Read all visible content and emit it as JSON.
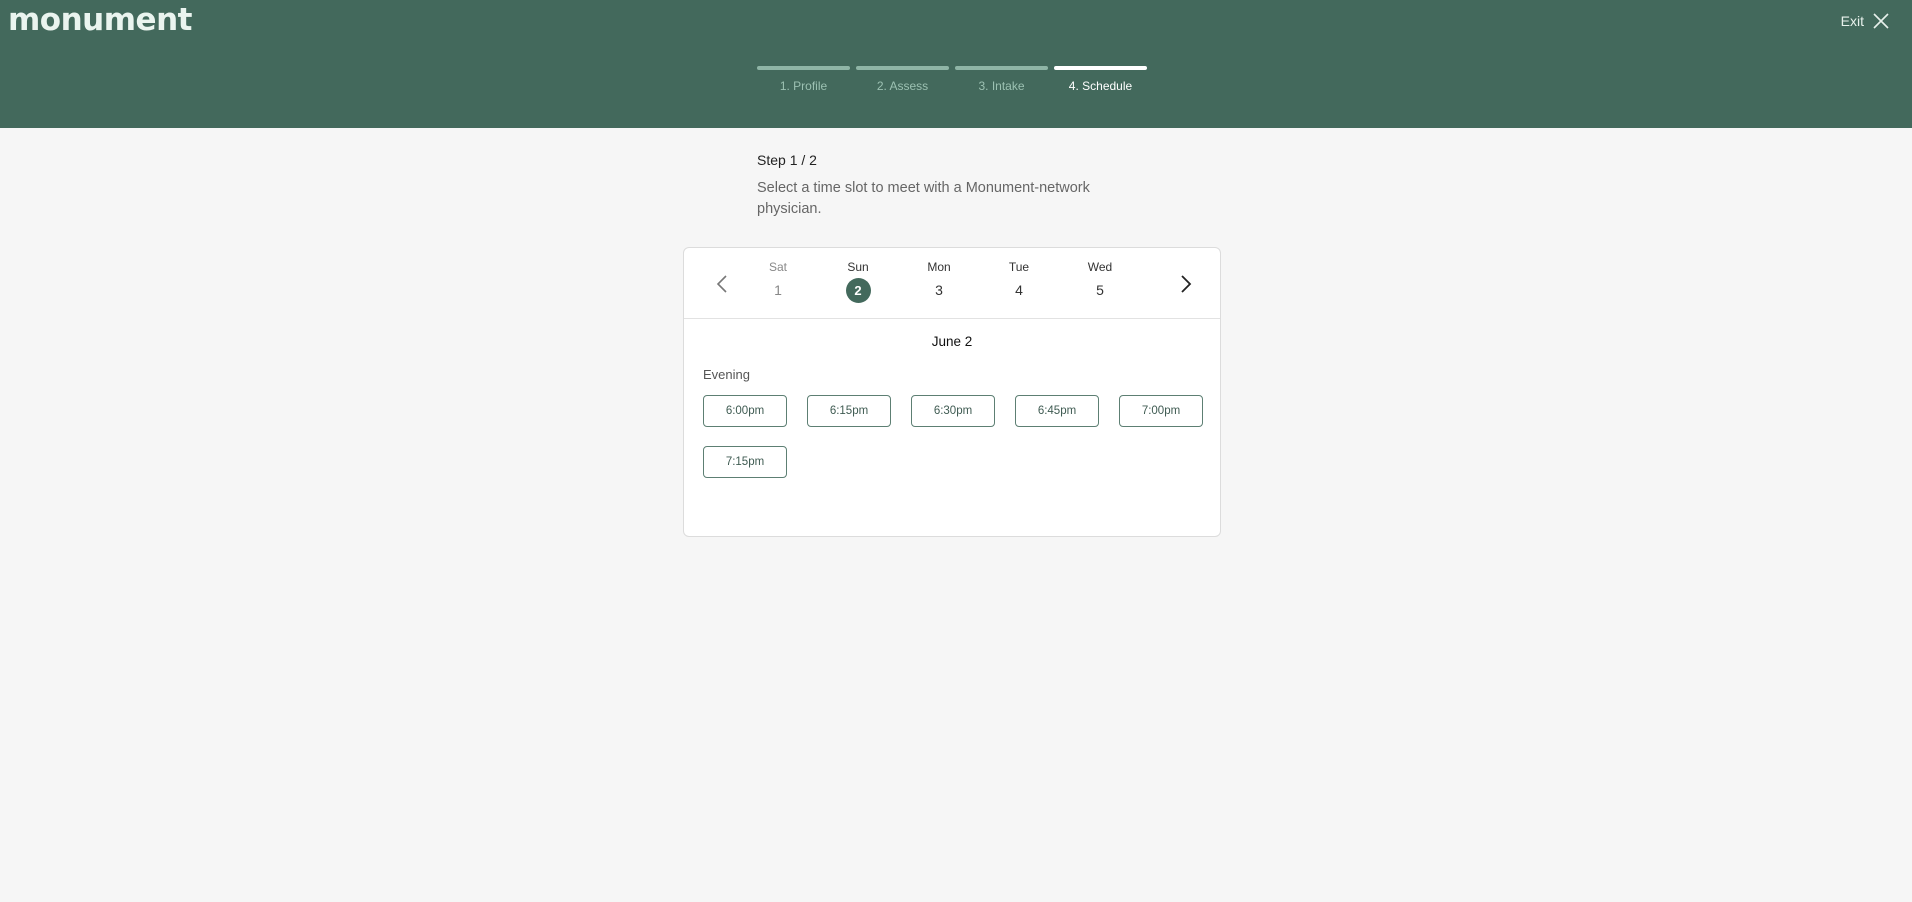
{
  "header": {
    "logo": "monument",
    "exit_label": "Exit",
    "background": "#43695c"
  },
  "stepper": {
    "steps": [
      {
        "label": "1. Profile",
        "active": false
      },
      {
        "label": "2. Assess",
        "active": false
      },
      {
        "label": "3. Intake",
        "active": false
      },
      {
        "label": "4. Schedule",
        "active": true
      }
    ]
  },
  "intro": {
    "step_count": "Step 1 / 2",
    "description": "Select a time slot to meet with a Monument-network physician."
  },
  "calendar": {
    "days": [
      {
        "name": "Sat",
        "date": "1"
      },
      {
        "name": "Sun",
        "date": "2"
      },
      {
        "name": "Mon",
        "date": "3"
      },
      {
        "name": "Tue",
        "date": "4"
      },
      {
        "name": "Wed",
        "date": "5"
      }
    ],
    "selected_date_title": "June 2",
    "period_label": "Evening",
    "slots": [
      "6:00pm",
      "6:15pm",
      "6:30pm",
      "6:45pm",
      "7:00pm",
      "7:15pm"
    ]
  }
}
